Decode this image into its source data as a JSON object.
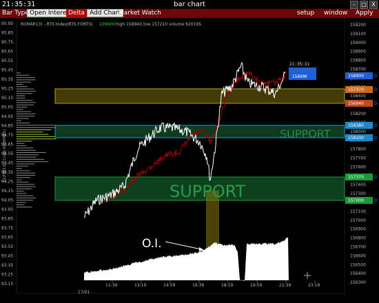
{
  "window": {
    "clock": "21:35:31",
    "title": "bar chart",
    "buttons": [
      "-",
      "□",
      "X"
    ]
  },
  "toolbar": {
    "bar_type": "Bar Type",
    "open_interest": "Open Interest",
    "delta": "Delta",
    "add_chart": "Add Chart",
    "market_watch": "Market Watch",
    "setup": "setup",
    "window": "window",
    "apply": "Apply"
  },
  "header": {
    "symbol": "RI(MAR13) - RTS Index(RTS FORTS)",
    "last": "158900",
    "high": "high 158940",
    "low": "low 157210",
    "volume": "volume 620195"
  },
  "left_axis": {
    "title": "CL(FEB13) - Crude Oil(NYMEX)",
    "labels": [
      "95.95",
      "95.85",
      "95.75",
      "95.65",
      "95.55",
      "95.45",
      "95.35",
      "95.25",
      "95.15",
      "95.05",
      "94.95",
      "94.85",
      "94.75",
      "94.65",
      "94.55",
      "94.45",
      "94.35",
      "94.25",
      "94.15",
      "94.05",
      "93.95",
      "93.85",
      "93.75",
      "93.65",
      "93.55",
      "93.45",
      "93.35",
      "93.25",
      "93.15"
    ]
  },
  "right_axis": {
    "labels": [
      "159200",
      "159100",
      "159000",
      "158900",
      "158800",
      "158700",
      "158600",
      "158500",
      "158400",
      "158300",
      "158200",
      "158100",
      "158000",
      "157900",
      "157800",
      "157700",
      "157600",
      "157500",
      "157400",
      "157300",
      "157200",
      "157100",
      "157000",
      "156900",
      "156800",
      "156700",
      "156600",
      "156500",
      "156400",
      "156300"
    ],
    "tags": [
      {
        "text": "158900",
        "color": "#1f5fd8"
      },
      {
        "text": "157370",
        "color": "#d06a1a"
      },
      {
        "text": "156940",
        "color": "#c04a1a"
      },
      {
        "text": "158380",
        "color": "#1a8acc"
      },
      {
        "text": "158200",
        "color": "#1a8acc"
      },
      {
        "text": "157370",
        "color": "#1a9a3a"
      },
      {
        "text": "157000",
        "color": "#1a9a3a"
      }
    ],
    "cursor_time": "21:35:31"
  },
  "time_axis": {
    "date": "17/01",
    "labels": [
      "11:39",
      "13:19",
      "14:59",
      "16:39",
      "18:19",
      "19:59",
      "21:39",
      "23:19"
    ]
  },
  "annotations": {
    "support_label": "SUPPORT",
    "oi_label": "O.I."
  },
  "colors": {
    "resistance_zone": "#8a7a10",
    "support_zone": "#1a7a3a",
    "price_line": "#ffffff",
    "second_line": "#a00000",
    "toolbar": "#6b0808"
  }
}
